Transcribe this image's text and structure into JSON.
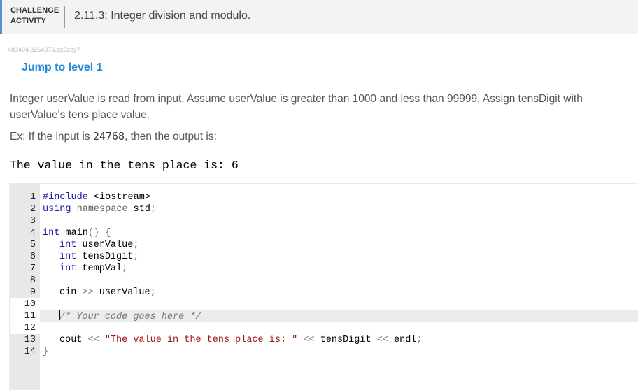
{
  "header": {
    "badge_line1": "CHALLENGE",
    "badge_line2": "ACTIVITY",
    "title": "2.11.3: Integer division and modulo."
  },
  "activity_id": "483494.3264376.qx3zqy7",
  "jump_link": "Jump to level 1",
  "prompt": "Integer userValue is read from input. Assume userValue is greater than 1000 and less than 99999. Assign tensDigit with userValue's tens place value.",
  "example": {
    "prefix": "Ex: If the input is ",
    "input": "24768",
    "suffix": ", then the output is:"
  },
  "expected_output": "The value in the tens place is: 6",
  "editor": {
    "line_numbers": [
      "1",
      "2",
      "3",
      "4",
      "5",
      "6",
      "7",
      "8",
      "9",
      "10",
      "11",
      "12",
      "13",
      "14"
    ],
    "active_line": 11,
    "lines": {
      "l1_kw": "#include",
      "l1_rest": " <iostream>",
      "l2_kw": "using",
      "l2_ns": " namespace",
      "l2_id": " std",
      "l2_semi": ";",
      "l4_kw": "int",
      "l4_id": " main",
      "l4_paren": "()",
      "l4_brace": " {",
      "l5_kw": "int",
      "l5_id": " userValue",
      "l5_semi": ";",
      "l6_kw": "int",
      "l6_id": " tensDigit",
      "l6_semi": ";",
      "l7_kw": "int",
      "l7_id": " tempVal",
      "l7_semi": ";",
      "l9_id": "cin",
      "l9_op": " >>",
      "l9_var": " userValue",
      "l9_semi": ";",
      "l11_comment": "/* Your code goes here */",
      "l13_id": "cout",
      "l13_op1": " <<",
      "l13_str": " \"The value in the tens place is: \"",
      "l13_op2": " <<",
      "l13_var": " tensDigit",
      "l13_op3": " <<",
      "l13_endl": " endl",
      "l13_semi": ";",
      "l14_brace": "}"
    }
  }
}
